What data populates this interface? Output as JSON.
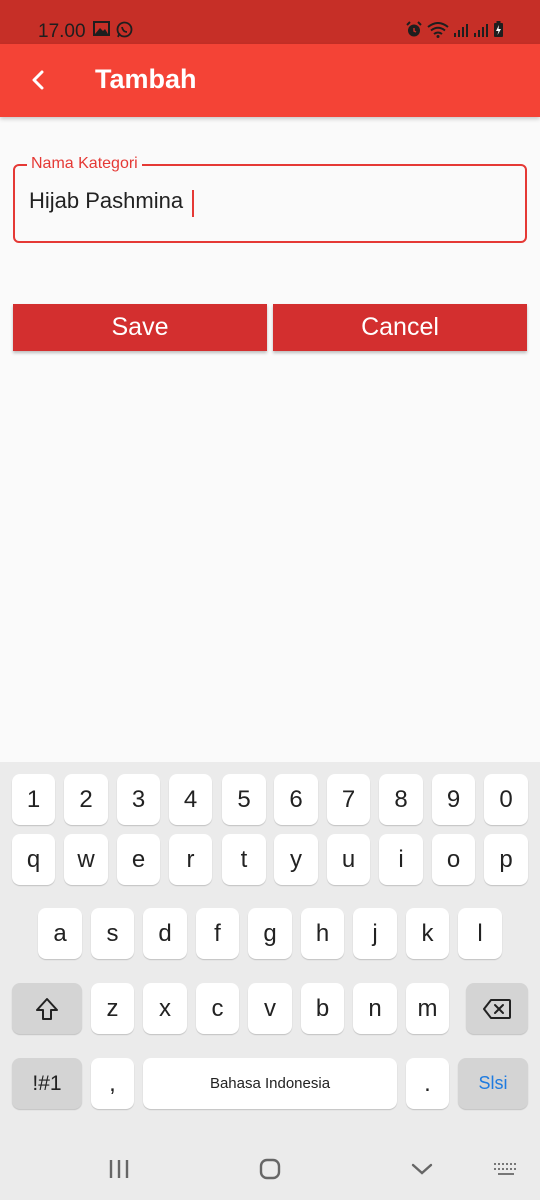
{
  "status_bar": {
    "time": "17.00"
  },
  "app_bar": {
    "title": "Tambah"
  },
  "form": {
    "field_label": "Nama Kategori",
    "field_value": "Hijab Pashmina"
  },
  "buttons": {
    "save": "Save",
    "cancel": "Cancel"
  },
  "keyboard": {
    "row_numbers": [
      "1",
      "2",
      "3",
      "4",
      "5",
      "6",
      "7",
      "8",
      "9",
      "0"
    ],
    "row_1": [
      "q",
      "w",
      "e",
      "r",
      "t",
      "y",
      "u",
      "i",
      "o",
      "p"
    ],
    "row_2": [
      "a",
      "s",
      "d",
      "f",
      "g",
      "h",
      "j",
      "k",
      "l"
    ],
    "row_3": [
      "z",
      "x",
      "c",
      "v",
      "b",
      "n",
      "m"
    ],
    "symbols_key": "!#1",
    "comma_key": ",",
    "space_label": "Bahasa Indonesia",
    "period_key": ".",
    "enter_label": "Slsi"
  },
  "colors": {
    "app_bar": "#f44336",
    "status_bar": "#c62f27",
    "accent": "#e53935",
    "button": "#d32f2f"
  }
}
